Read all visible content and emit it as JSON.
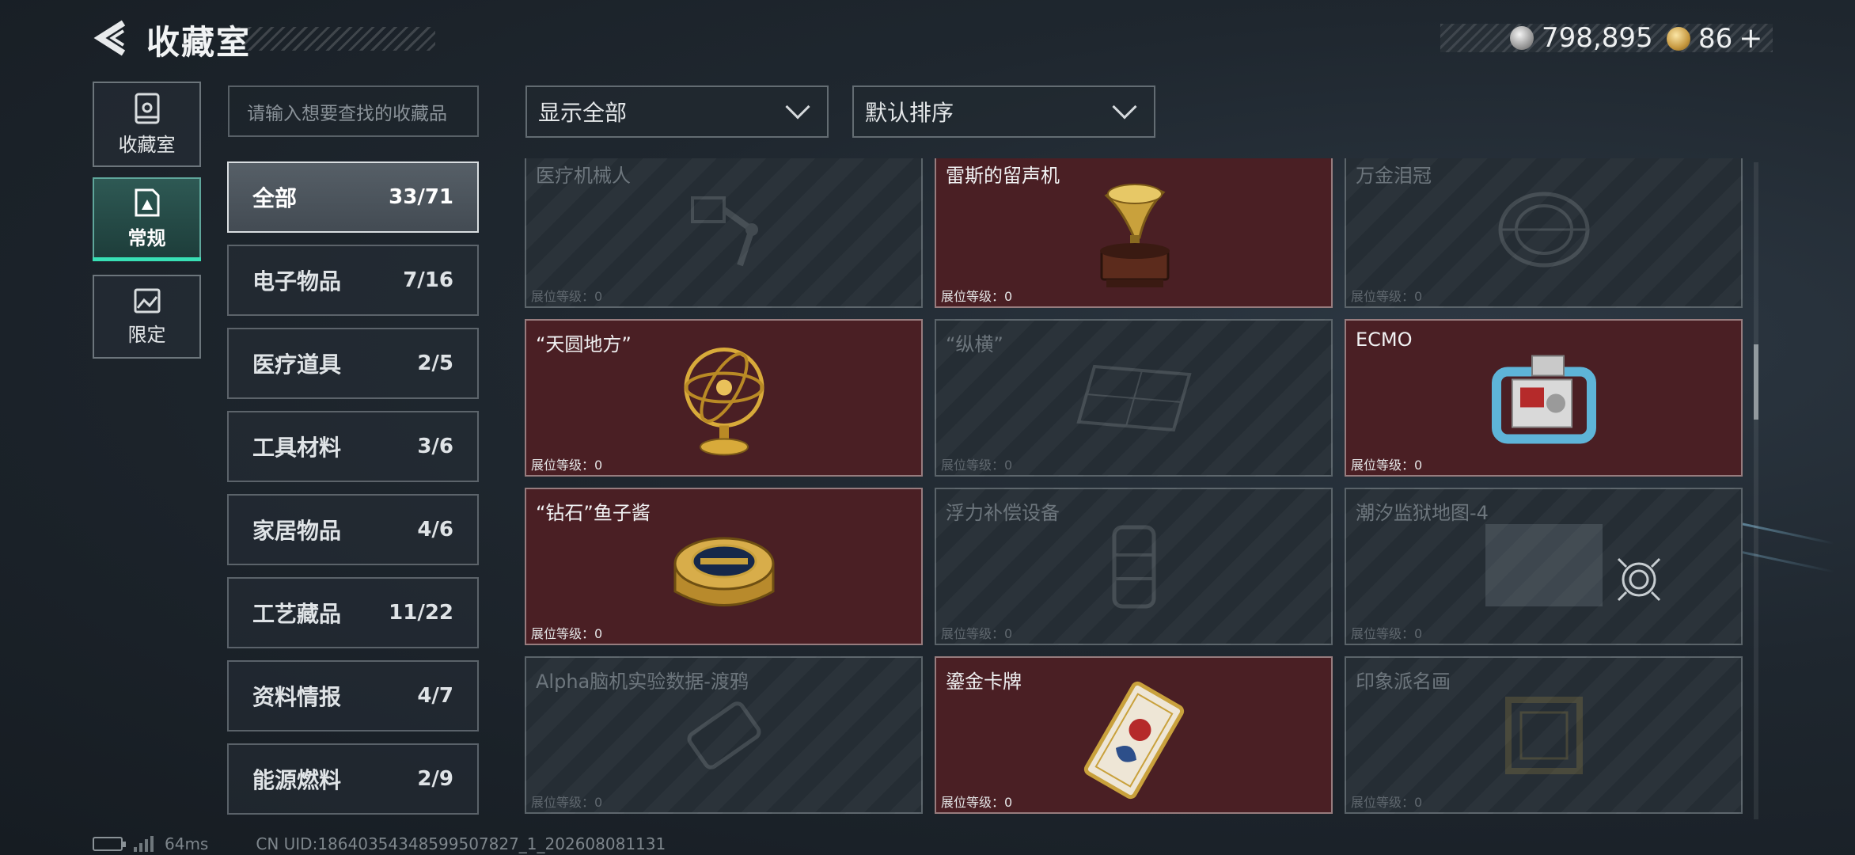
{
  "header": {
    "title": "收藏室",
    "currency": [
      {
        "icon": "silver-coin-icon",
        "amount": "798,895"
      },
      {
        "icon": "gold-coin-icon",
        "amount": "86"
      }
    ],
    "add_label": "+"
  },
  "rail": [
    {
      "label": "收藏室",
      "icon": "collection-room-icon"
    },
    {
      "label": "常规",
      "icon": "regular-icon"
    },
    {
      "label": "限定",
      "icon": "limited-icon"
    }
  ],
  "search": {
    "placeholder": "请输入想要查找的收藏品"
  },
  "categories": [
    {
      "name": "全部",
      "count": "33/71"
    },
    {
      "name": "电子物品",
      "count": "7/16"
    },
    {
      "name": "医疗道具",
      "count": "2/5"
    },
    {
      "name": "工具材料",
      "count": "3/6"
    },
    {
      "name": "家居物品",
      "count": "4/6"
    },
    {
      "name": "工艺藏品",
      "count": "11/22"
    },
    {
      "name": "资料情报",
      "count": "4/7"
    },
    {
      "name": "能源燃料",
      "count": "2/9"
    }
  ],
  "filters": {
    "show": "显示全部",
    "sort": "默认排序"
  },
  "level_label": "展位等级：0",
  "items": [
    {
      "name": "医疗机械人",
      "owned": false,
      "icon": "robot-arm-icon"
    },
    {
      "name": "雷斯的留声机",
      "owned": true,
      "icon": "gramophone-icon"
    },
    {
      "name": "万金泪冠",
      "owned": false,
      "icon": "crown-icon"
    },
    {
      "name": "“天圆地方”",
      "owned": true,
      "icon": "armillary-sphere-icon"
    },
    {
      "name": "“纵横”",
      "owned": false,
      "icon": "chessboard-icon"
    },
    {
      "name": "ECMO",
      "owned": true,
      "icon": "ecmo-machine-icon"
    },
    {
      "name": "“钻石”鱼子酱",
      "owned": true,
      "icon": "caviar-tin-icon"
    },
    {
      "name": "浮力补偿设备",
      "owned": false,
      "icon": "diving-gear-icon"
    },
    {
      "name": "潮汐监狱地图-4",
      "owned": false,
      "icon": "map-icon"
    },
    {
      "name": "Alpha脑机实验数据-渡鸦",
      "owned": false,
      "icon": "data-drive-icon"
    },
    {
      "name": "鎏金卡牌",
      "owned": true,
      "icon": "gilded-card-icon"
    },
    {
      "name": "印象派名画",
      "owned": false,
      "icon": "painting-icon"
    }
  ],
  "footer": {
    "latency": "64ms",
    "uid": "CN UID:18640354348599507827_1_202608081131"
  },
  "colors": {
    "accent": "#38e0b5",
    "owned_card": "#4a1f24",
    "gold": "#c6983f"
  }
}
